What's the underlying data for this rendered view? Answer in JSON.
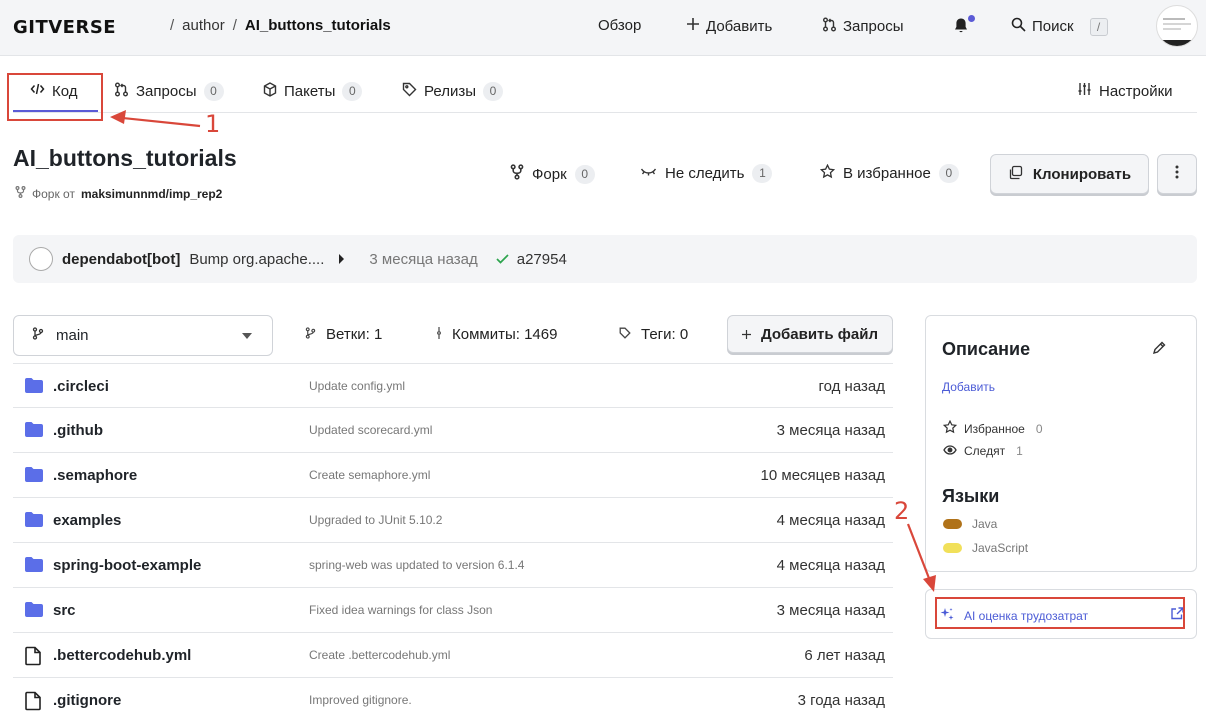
{
  "header": {
    "logo": "GITVERSE",
    "breadcrumbs": [
      "author",
      "AI_buttons_tutorials"
    ],
    "nav": [
      {
        "label": "Обзор",
        "icon": "none"
      },
      {
        "label": "Добавить",
        "icon": "plus-icon"
      },
      {
        "label": "Запросы",
        "icon": "pull-request-icon"
      }
    ],
    "search_label": "Поиск",
    "search_shortcut": "/"
  },
  "tabs": [
    {
      "label": "Код",
      "count": null,
      "icon": "code-icon",
      "active": true
    },
    {
      "label": "Запросы",
      "count": "0",
      "icon": "pull-request-icon"
    },
    {
      "label": "Пакеты",
      "count": "0",
      "icon": "package-icon"
    },
    {
      "label": "Релизы",
      "count": "0",
      "icon": "tag-icon"
    }
  ],
  "settings_label": "Настройки",
  "repo": {
    "name": "AI_buttons_tutorials",
    "fork_prefix": "Форк от",
    "fork_source": "maksimunnmd/imp_rep2",
    "fork": {
      "label": "Форк",
      "count": "0"
    },
    "watch": {
      "label": "Не следить",
      "count": "1"
    },
    "star": {
      "label": "В избранное",
      "count": "0"
    },
    "clone_label": "Клонировать"
  },
  "last_commit": {
    "author": "dependabot[bot]",
    "message": "Bump org.apache....",
    "time": "3 месяца назад",
    "sha": "a27954"
  },
  "toolbar": {
    "branch": "main",
    "branches": "Ветки: 1",
    "commits": "Коммиты: 1469",
    "tags": "Теги: 0",
    "add_file": "Добавить файл"
  },
  "files": [
    {
      "name": ".circleci",
      "type": "folder",
      "message": "Update config.yml",
      "time": "год назад"
    },
    {
      "name": ".github",
      "type": "folder",
      "message": "Updated scorecard.yml",
      "time": "3 месяца назад"
    },
    {
      "name": ".semaphore",
      "type": "folder",
      "message": "Create semaphore.yml",
      "time": "10 месяцев назад"
    },
    {
      "name": "examples",
      "type": "folder",
      "message": "Upgraded to JUnit 5.10.2",
      "time": "4 месяца назад"
    },
    {
      "name": "spring-boot-example",
      "type": "folder",
      "message": "spring-web was updated to version 6.1.4",
      "time": "4 месяца назад"
    },
    {
      "name": "src",
      "type": "folder",
      "message": "Fixed idea warnings for class Json",
      "time": "3 месяца назад"
    },
    {
      "name": ".bettercodehub.yml",
      "type": "file",
      "message": "Create .bettercodehub.yml",
      "time": "6 лет назад"
    },
    {
      "name": ".gitignore",
      "type": "file",
      "message": "Improved gitignore.",
      "time": "3 года назад"
    }
  ],
  "sidebar": {
    "description_title": "Описание",
    "description_add": "Добавить",
    "favorites_label": "Избранное",
    "favorites_count": "0",
    "watchers_label": "Следят",
    "watchers_count": "1",
    "languages_title": "Языки",
    "languages": [
      {
        "name": "Java",
        "color": "#b07219"
      },
      {
        "name": "JavaScript",
        "color": "#f1e05a"
      }
    ],
    "ai_estimate_label": "AI оценка трудозатрат"
  },
  "annotations": {
    "label_1": "1",
    "label_2": "2",
    "color": "#d9473a"
  },
  "colors": {
    "accent": "#5b5bd6",
    "folder": "#5b6ee8",
    "success": "#2da44e"
  }
}
